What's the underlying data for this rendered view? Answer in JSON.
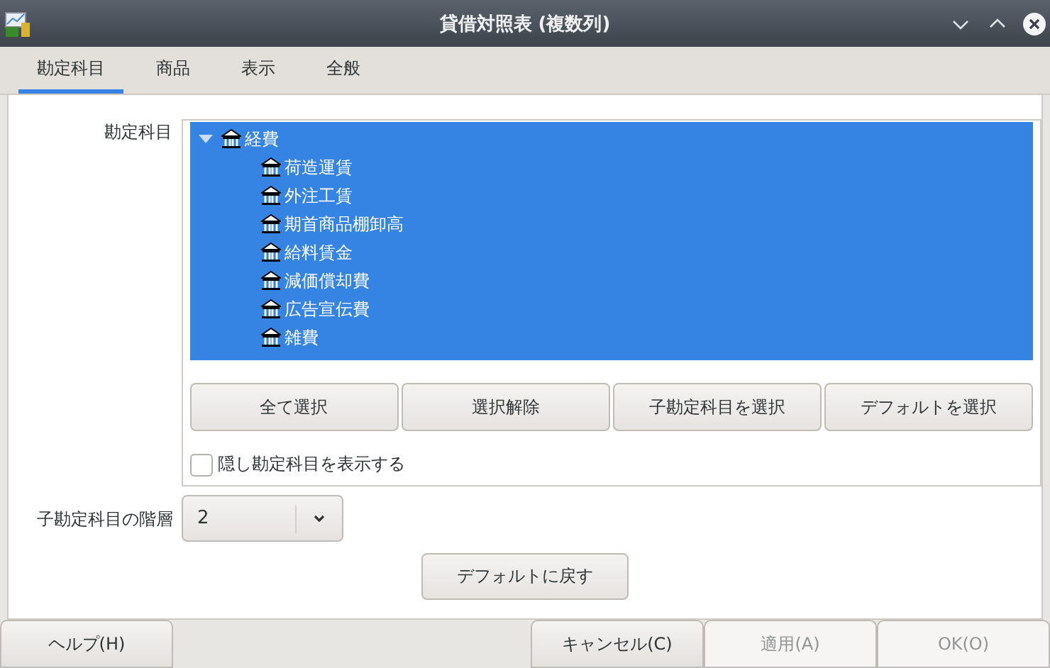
{
  "window": {
    "title": "貸借対照表 (複数列)"
  },
  "tabs": [
    {
      "label": "勘定科目",
      "selected": true
    },
    {
      "label": "商品",
      "selected": false
    },
    {
      "label": "表示",
      "selected": false
    },
    {
      "label": "全般",
      "selected": false
    }
  ],
  "accounts": {
    "label": "勘定科目",
    "tree": [
      {
        "name": "経費",
        "expanded": true,
        "selected": true,
        "children": [
          {
            "name": "荷造運賃",
            "selected": true
          },
          {
            "name": "外注工賃",
            "selected": true
          },
          {
            "name": "期首商品棚卸高",
            "selected": true
          },
          {
            "name": "給料賃金",
            "selected": true
          },
          {
            "name": "減価償却費",
            "selected": true
          },
          {
            "name": "広告宣伝費",
            "selected": true
          },
          {
            "name": "雑費",
            "selected": true
          }
        ]
      }
    ],
    "buttons": [
      "全て選択",
      "選択解除",
      "子勘定科目を選択",
      "デフォルトを選択"
    ],
    "show_hidden": {
      "label": "隠し勘定科目を表示する",
      "checked": false
    }
  },
  "depth": {
    "label": "子勘定科目の階層",
    "value": "2"
  },
  "reset_button": "デフォルトに戻す",
  "footer_left": [
    {
      "label": "ヘルプ(H)",
      "disabled": false
    }
  ],
  "footer_right": [
    {
      "label": "キャンセル(C)",
      "disabled": false
    },
    {
      "label": "適用(A)",
      "disabled": true
    },
    {
      "label": "OK(O)",
      "disabled": true
    }
  ]
}
